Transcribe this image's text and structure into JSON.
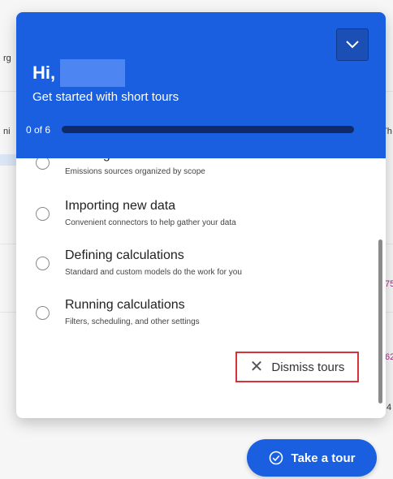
{
  "background": {
    "fragments": [
      "rg",
      "ni",
      "Th",
      "75",
      "62",
      "4"
    ]
  },
  "header": {
    "greeting": "Hi,",
    "subtitle": "Get started with short tours",
    "progress_label": "0 of 6",
    "progress_fraction": 0.0,
    "collapse_icon": "chevron-down-icon",
    "color": "#1a5fe0"
  },
  "tours": [
    {
      "title": "Viewing emissions",
      "description": "Emissions sources organized by scope"
    },
    {
      "title": "Importing new data",
      "description": "Convenient connectors to help gather your data"
    },
    {
      "title": "Defining calculations",
      "description": "Standard and custom models do the work for you"
    },
    {
      "title": "Running calculations",
      "description": "Filters, scheduling, and other settings"
    }
  ],
  "dismiss": {
    "label": "Dismiss tours",
    "icon": "close-icon",
    "highlight_color": "#d8313a"
  },
  "take_tour": {
    "label": "Take a tour",
    "icon": "check-circle-icon"
  }
}
